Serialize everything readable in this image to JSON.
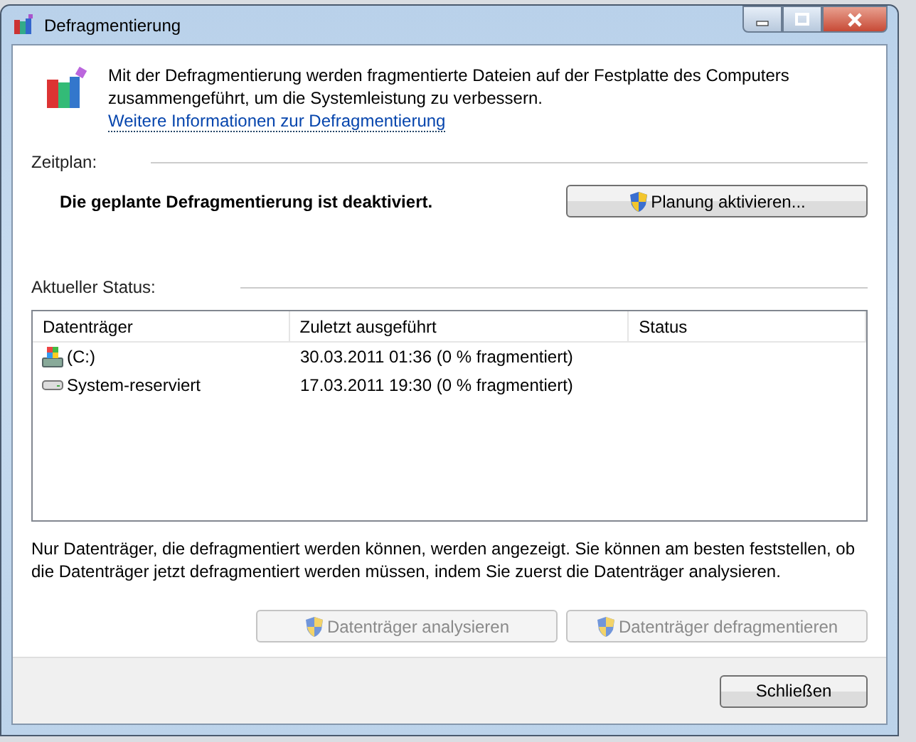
{
  "window": {
    "title": "Defragmentierung"
  },
  "intro": {
    "text": "Mit der Defragmentierung werden fragmentierte Dateien auf der Festplatte des Computers zusammengeführt, um die Systemleistung zu verbessern.",
    "link": "Weitere Informationen zur Defragmentierung"
  },
  "schedule": {
    "heading": "Zeitplan:",
    "message": "Die geplante Defragmentierung ist deaktiviert.",
    "button": {
      "label": "Planung aktivieren...",
      "shield": true,
      "disabled": false
    }
  },
  "status": {
    "heading": "Aktueller Status:",
    "table": {
      "columns": [
        "Datenträger",
        "Zuletzt ausgeführt",
        "Status"
      ],
      "rows": [
        {
          "kind": "system",
          "name": "(C:)",
          "last_run": "30.03.2011 01:36 (0 % fragmentiert)",
          "selected": false
        },
        {
          "kind": "drive",
          "name": "System-reserviert",
          "last_run": "17.03.2011 19:30 (0 % fragmentiert)",
          "selected": false
        }
      ]
    }
  },
  "note": "Nur Datenträger, die defragmentiert werden können, werden angezeigt. Sie können am besten feststellen, ob die Datenträger jetzt defragmentiert werden müssen, indem Sie zuerst die Datenträger analysieren.",
  "actions": [
    {
      "label": "Datenträger analysieren",
      "shield": true,
      "disabled": true
    },
    {
      "label": "Datenträger defragmentieren",
      "shield": true,
      "disabled": true
    }
  ],
  "footer": {
    "button": "Schließen"
  }
}
